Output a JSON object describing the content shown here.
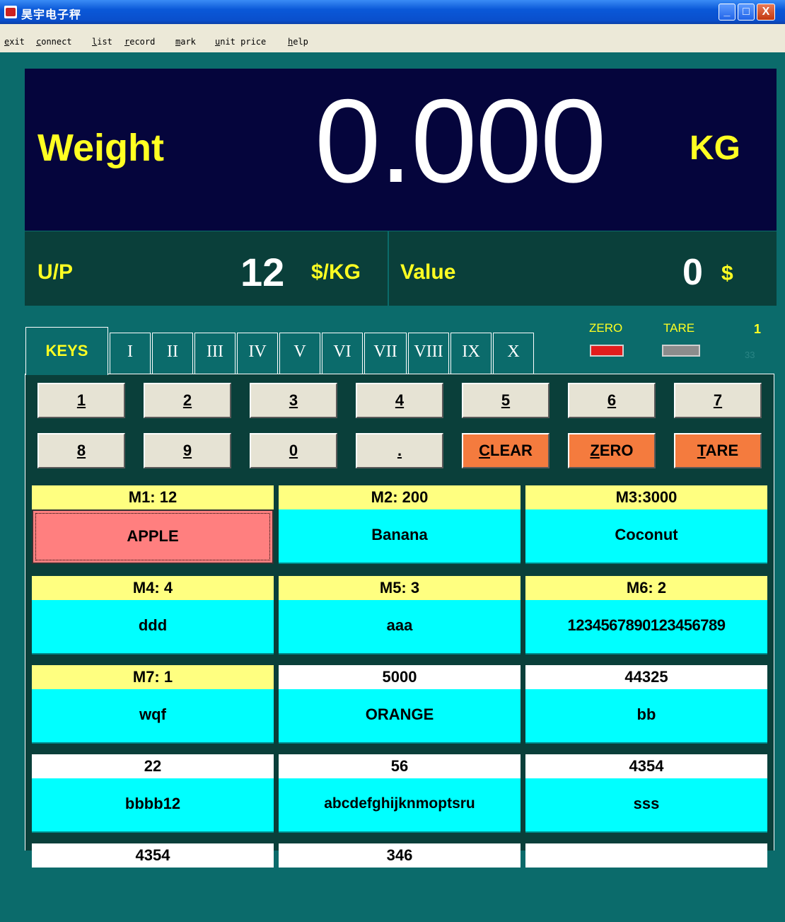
{
  "window": {
    "title": "昊宇电子秤",
    "min_label": "_",
    "max_label": "□",
    "close_label": "X"
  },
  "menu": [
    "exit",
    "connect",
    "list",
    "record",
    "mark",
    "unit price",
    "help"
  ],
  "display": {
    "weight_label": "Weight",
    "weight_value": "0.000",
    "weight_unit": "KG",
    "up_label": "U/P",
    "up_value": "12",
    "up_unit": "$/KG",
    "value_label": "Value",
    "value_value": "0",
    "value_unit": "$"
  },
  "tabs": {
    "active": "KEYS",
    "items": [
      "I",
      "II",
      "III",
      "IV",
      "V",
      "VI",
      "VII",
      "VIII",
      "IX",
      "X"
    ]
  },
  "indicators": {
    "zero_label": "ZERO",
    "tare_label": "TARE",
    "zero_color": "#e21c1c",
    "tare_color": "#8c8c8c",
    "count": "1",
    "count2": "33"
  },
  "keypad": {
    "row1": [
      "1",
      "2",
      "3",
      "4",
      "5",
      "6",
      "7"
    ],
    "row2": [
      "8",
      "9",
      "0",
      "."
    ],
    "clear": {
      "ul": "C",
      "rest": "LEAR"
    },
    "zero": {
      "ul": "Z",
      "rest": "ERO"
    },
    "tare": {
      "ul": "T",
      "rest": "ARE"
    }
  },
  "products": [
    {
      "head": "M1: 12",
      "name": "APPLE"
    },
    {
      "head": "M2: 200",
      "name": "Banana"
    },
    {
      "head": "M3:3000",
      "name": "Coconut"
    },
    {
      "head": "M4: 4",
      "name": "ddd"
    },
    {
      "head": "M5: 3",
      "name": "aaa"
    },
    {
      "head": "M6: 2",
      "name": "1234567890123456789"
    },
    {
      "head": "M7: 1",
      "name": "wqf"
    },
    {
      "head": "5000",
      "name": "ORANGE"
    },
    {
      "head": "44325",
      "name": "bb"
    },
    {
      "head": "22",
      "name": "bbbb12"
    },
    {
      "head": "56",
      "name": "abcdefghijknmoptsru"
    },
    {
      "head": "4354",
      "name": "sss"
    },
    {
      "head": "4354",
      "name": ""
    },
    {
      "head": "346",
      "name": ""
    },
    {
      "head": "",
      "name": ""
    }
  ]
}
